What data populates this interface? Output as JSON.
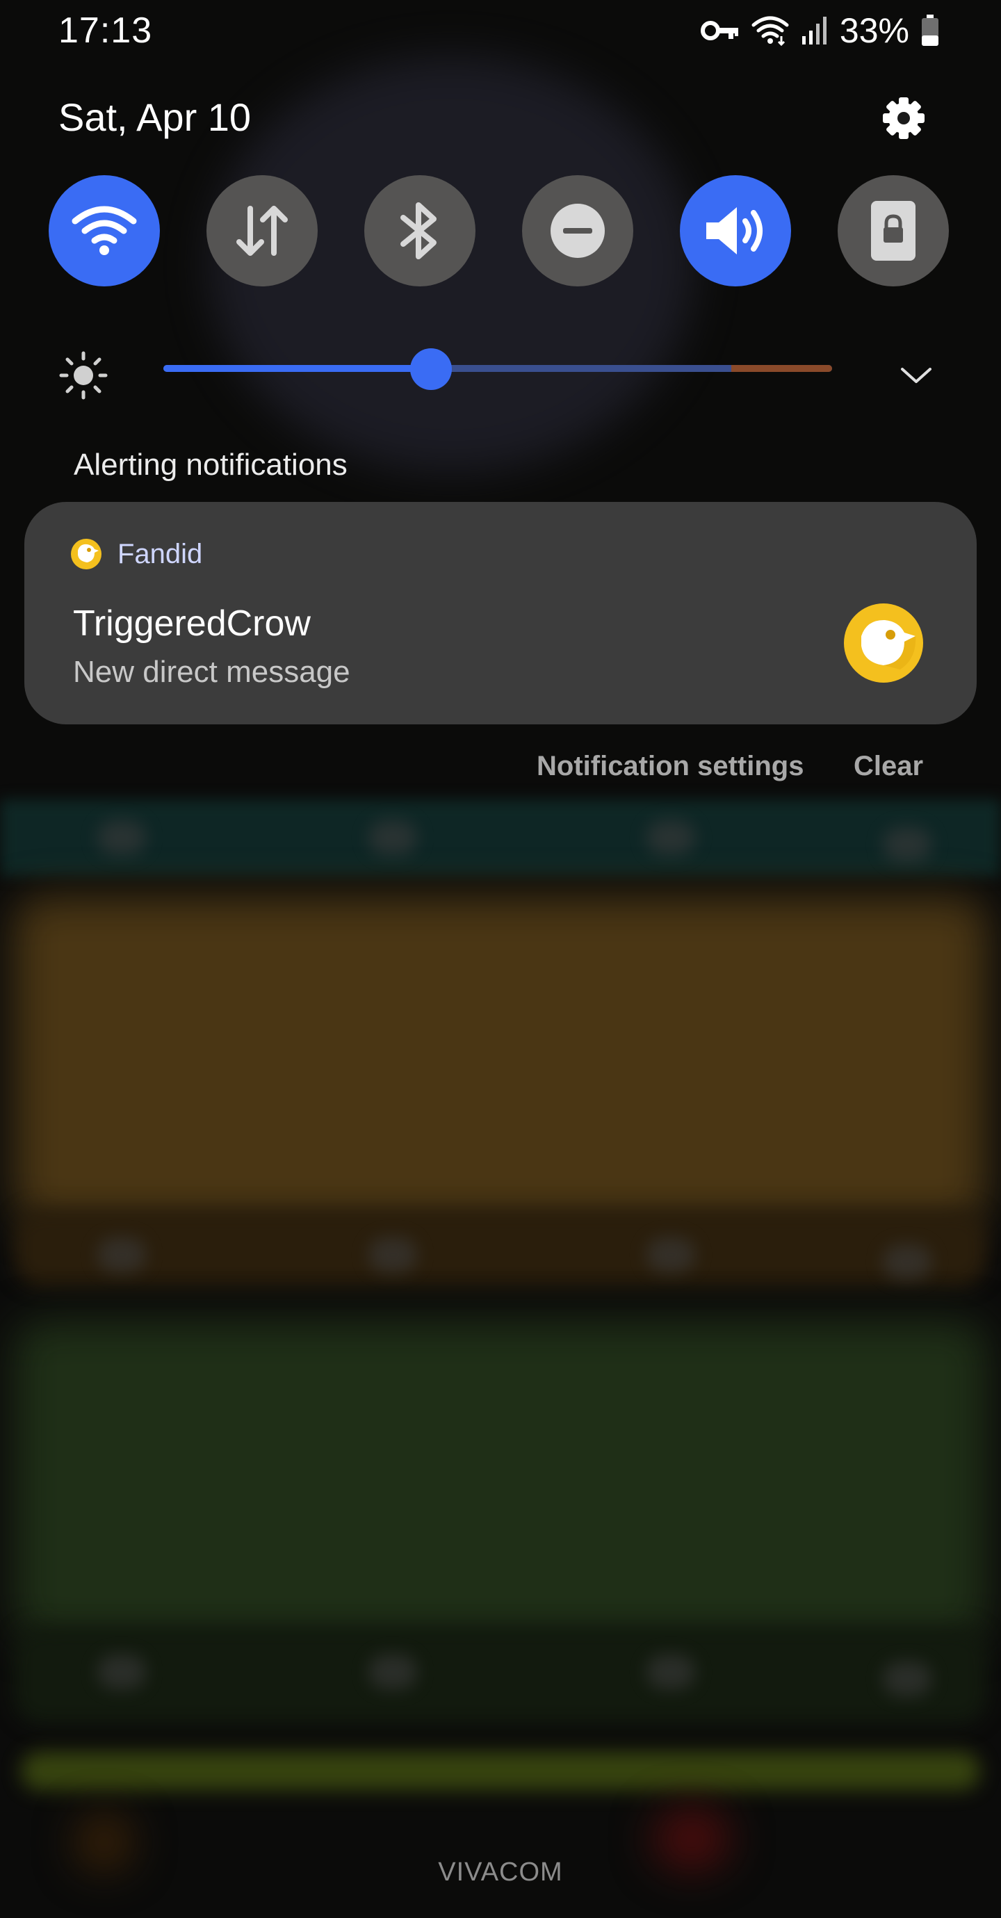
{
  "status_bar": {
    "time": "17:13",
    "battery_percent": "33%",
    "icons": [
      "vpn-key-icon",
      "wifi-icon",
      "signal-icon",
      "battery-icon"
    ]
  },
  "header": {
    "date": "Sat, Apr 10",
    "settings_icon": "gear-icon"
  },
  "quick_toggles": [
    {
      "name": "wifi",
      "icon": "wifi-icon",
      "active": true
    },
    {
      "name": "mobile-data",
      "icon": "data-arrows-icon",
      "active": false
    },
    {
      "name": "bluetooth",
      "icon": "bluetooth-icon",
      "active": false
    },
    {
      "name": "do-not-disturb",
      "icon": "minus-circle-icon",
      "active": false
    },
    {
      "name": "sound",
      "icon": "speaker-icon",
      "active": true
    },
    {
      "name": "screen-lock",
      "icon": "lock-icon",
      "active": false
    }
  ],
  "brightness": {
    "level": 0.4,
    "icon": "sun-icon",
    "expand_icon": "chevron-down-icon"
  },
  "notifications": {
    "section_title": "Alerting notifications",
    "items": [
      {
        "app_name": "Fandid",
        "title": "TriggeredCrow",
        "text": "New direct message",
        "accent": "#f4c01e"
      }
    ],
    "actions": {
      "settings_label": "Notification settings",
      "clear_label": "Clear"
    }
  },
  "colors": {
    "accent": "#3a6cf4",
    "toggle_off": "#555453",
    "card": "#3c3c3c"
  },
  "carrier": "VIVACOM"
}
